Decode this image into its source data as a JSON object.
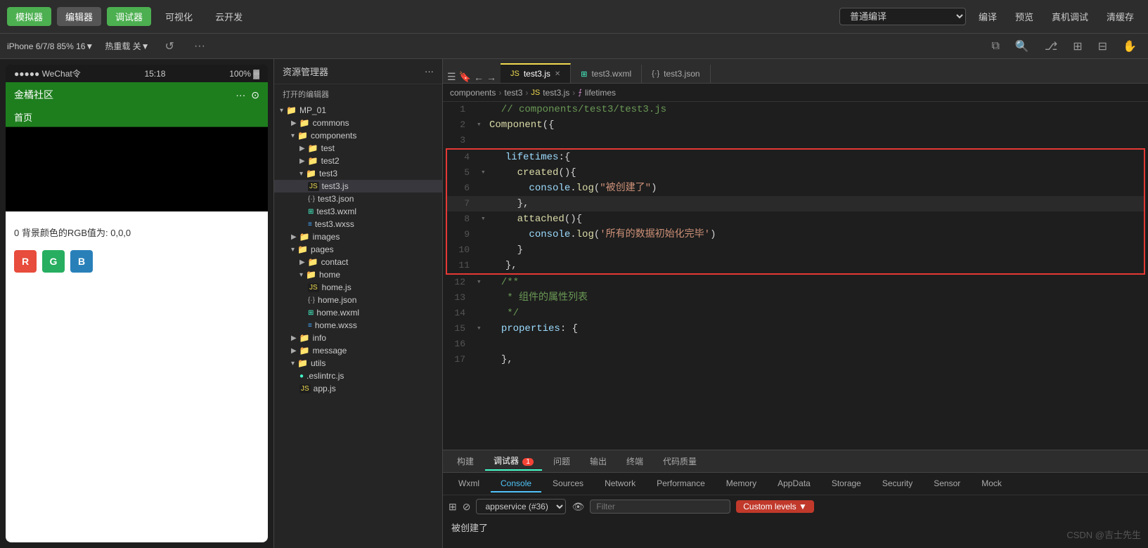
{
  "topToolbar": {
    "buttons": [
      "模拟器",
      "编辑器",
      "调试器",
      "可视化",
      "云开发"
    ],
    "rightButtons": [
      "编译",
      "预览",
      "真机调试",
      "清缓存"
    ],
    "compileBtn": "普通编译",
    "activeBtn": "调试器"
  },
  "secondToolbar": {
    "device": "iPhone 6/7/8 85% 16▼",
    "hotReload": "热重载 关▼",
    "icons": [
      "↺",
      "···"
    ]
  },
  "fileTree": {
    "title": "资源管理器",
    "menuIcon": "···",
    "openedEditors": "打开的编辑器",
    "root": "MP_01",
    "items": [
      {
        "label": "commons",
        "type": "folder",
        "indent": 1
      },
      {
        "label": "components",
        "type": "folder",
        "indent": 1,
        "expanded": true
      },
      {
        "label": "test",
        "type": "folder",
        "indent": 2
      },
      {
        "label": "test2",
        "type": "folder",
        "indent": 2
      },
      {
        "label": "test3",
        "type": "folder",
        "indent": 2,
        "expanded": true
      },
      {
        "label": "test3.js",
        "type": "js",
        "indent": 3,
        "active": true
      },
      {
        "label": "test3.json",
        "type": "json",
        "indent": 3
      },
      {
        "label": "test3.wxml",
        "type": "wxml",
        "indent": 3
      },
      {
        "label": "test3.wxss",
        "type": "wxss",
        "indent": 3
      },
      {
        "label": "images",
        "type": "folder",
        "indent": 1
      },
      {
        "label": "pages",
        "type": "folder",
        "indent": 1,
        "expanded": true
      },
      {
        "label": "contact",
        "type": "folder",
        "indent": 2
      },
      {
        "label": "home",
        "type": "folder",
        "indent": 2,
        "expanded": true
      },
      {
        "label": "home.js",
        "type": "js",
        "indent": 3
      },
      {
        "label": "home.json",
        "type": "json",
        "indent": 3
      },
      {
        "label": "home.wxml",
        "type": "wxml",
        "indent": 3
      },
      {
        "label": "home.wxss",
        "type": "wxss",
        "indent": 3
      },
      {
        "label": "info",
        "type": "folder",
        "indent": 1
      },
      {
        "label": "message",
        "type": "folder",
        "indent": 1
      },
      {
        "label": "utils",
        "type": "folder",
        "indent": 1,
        "expanded": true
      },
      {
        "label": ".eslintrc.js",
        "type": "js",
        "indent": 2
      },
      {
        "label": "app.js",
        "type": "js",
        "indent": 2
      }
    ]
  },
  "editorTabs": [
    {
      "label": "test3.js",
      "type": "js",
      "active": true
    },
    {
      "label": "test3.wxml",
      "type": "wxml",
      "active": false
    },
    {
      "label": "test3.json",
      "type": "json",
      "active": false
    }
  ],
  "breadcrumb": {
    "items": [
      "components",
      "test3",
      "test3.js",
      "lifetimes"
    ]
  },
  "codeLines": [
    {
      "num": 1,
      "content": "  // components/test3/test3.js",
      "type": "comment"
    },
    {
      "num": 2,
      "content": "▾ Component({",
      "type": "code"
    },
    {
      "num": 3,
      "content": "",
      "type": "code"
    },
    {
      "num": 4,
      "content": "  lifetimes:{",
      "type": "highlighted"
    },
    {
      "num": 5,
      "content": "    created(){",
      "type": "highlighted"
    },
    {
      "num": 6,
      "content": "      console.log(\"被创建了\")",
      "type": "highlighted"
    },
    {
      "num": 7,
      "content": "    },",
      "type": "highlighted",
      "lineHighlight": true
    },
    {
      "num": 8,
      "content": "    attached(){",
      "type": "highlighted"
    },
    {
      "num": 9,
      "content": "      console.log('所有的数据初始化完毕')",
      "type": "highlighted"
    },
    {
      "num": 10,
      "content": "    }",
      "type": "highlighted"
    },
    {
      "num": 11,
      "content": "  },",
      "type": "highlighted"
    },
    {
      "num": 12,
      "content": "▾ /**",
      "type": "comment_block"
    },
    {
      "num": 13,
      "content": "   * 组件的属性列表",
      "type": "comment_block"
    },
    {
      "num": 14,
      "content": "   */",
      "type": "comment_block"
    },
    {
      "num": 15,
      "content": "▾ properties: {",
      "type": "code"
    },
    {
      "num": 16,
      "content": "",
      "type": "code"
    },
    {
      "num": 17,
      "content": "  },",
      "type": "code"
    }
  ],
  "phoneSimulator": {
    "statusBar": {
      "signal": "●●●●● WeChat令",
      "time": "15:18",
      "battery": "100% ▓"
    },
    "titleBar": "金橘社区",
    "nav": "首页",
    "infoText": "0 背景颜色的RGB值为: 0,0,0",
    "rgbBtns": [
      {
        "label": "R",
        "color": "#e74c3c"
      },
      {
        "label": "G",
        "color": "#27ae60"
      },
      {
        "label": "B",
        "color": "#2980b9"
      }
    ]
  },
  "bottomPanel": {
    "tabs": [
      "构建",
      "调试器",
      "问题",
      "输出",
      "终端",
      "代码质量"
    ],
    "activeTab": "调试器",
    "badge": "1",
    "devtoolsTabs": [
      "Wxml",
      "Console",
      "Sources",
      "Network",
      "Performance",
      "Memory",
      "AppData",
      "Storage",
      "Security",
      "Sensor",
      "Mock"
    ],
    "activeDevtoolsTab": "Console",
    "appservice": "appservice (#36)",
    "filterPlaceholder": "Filter",
    "customLevels": "Custom levels ▼",
    "consoleOutput": "被创建了"
  },
  "csdn": "CSDN @吉士先生"
}
